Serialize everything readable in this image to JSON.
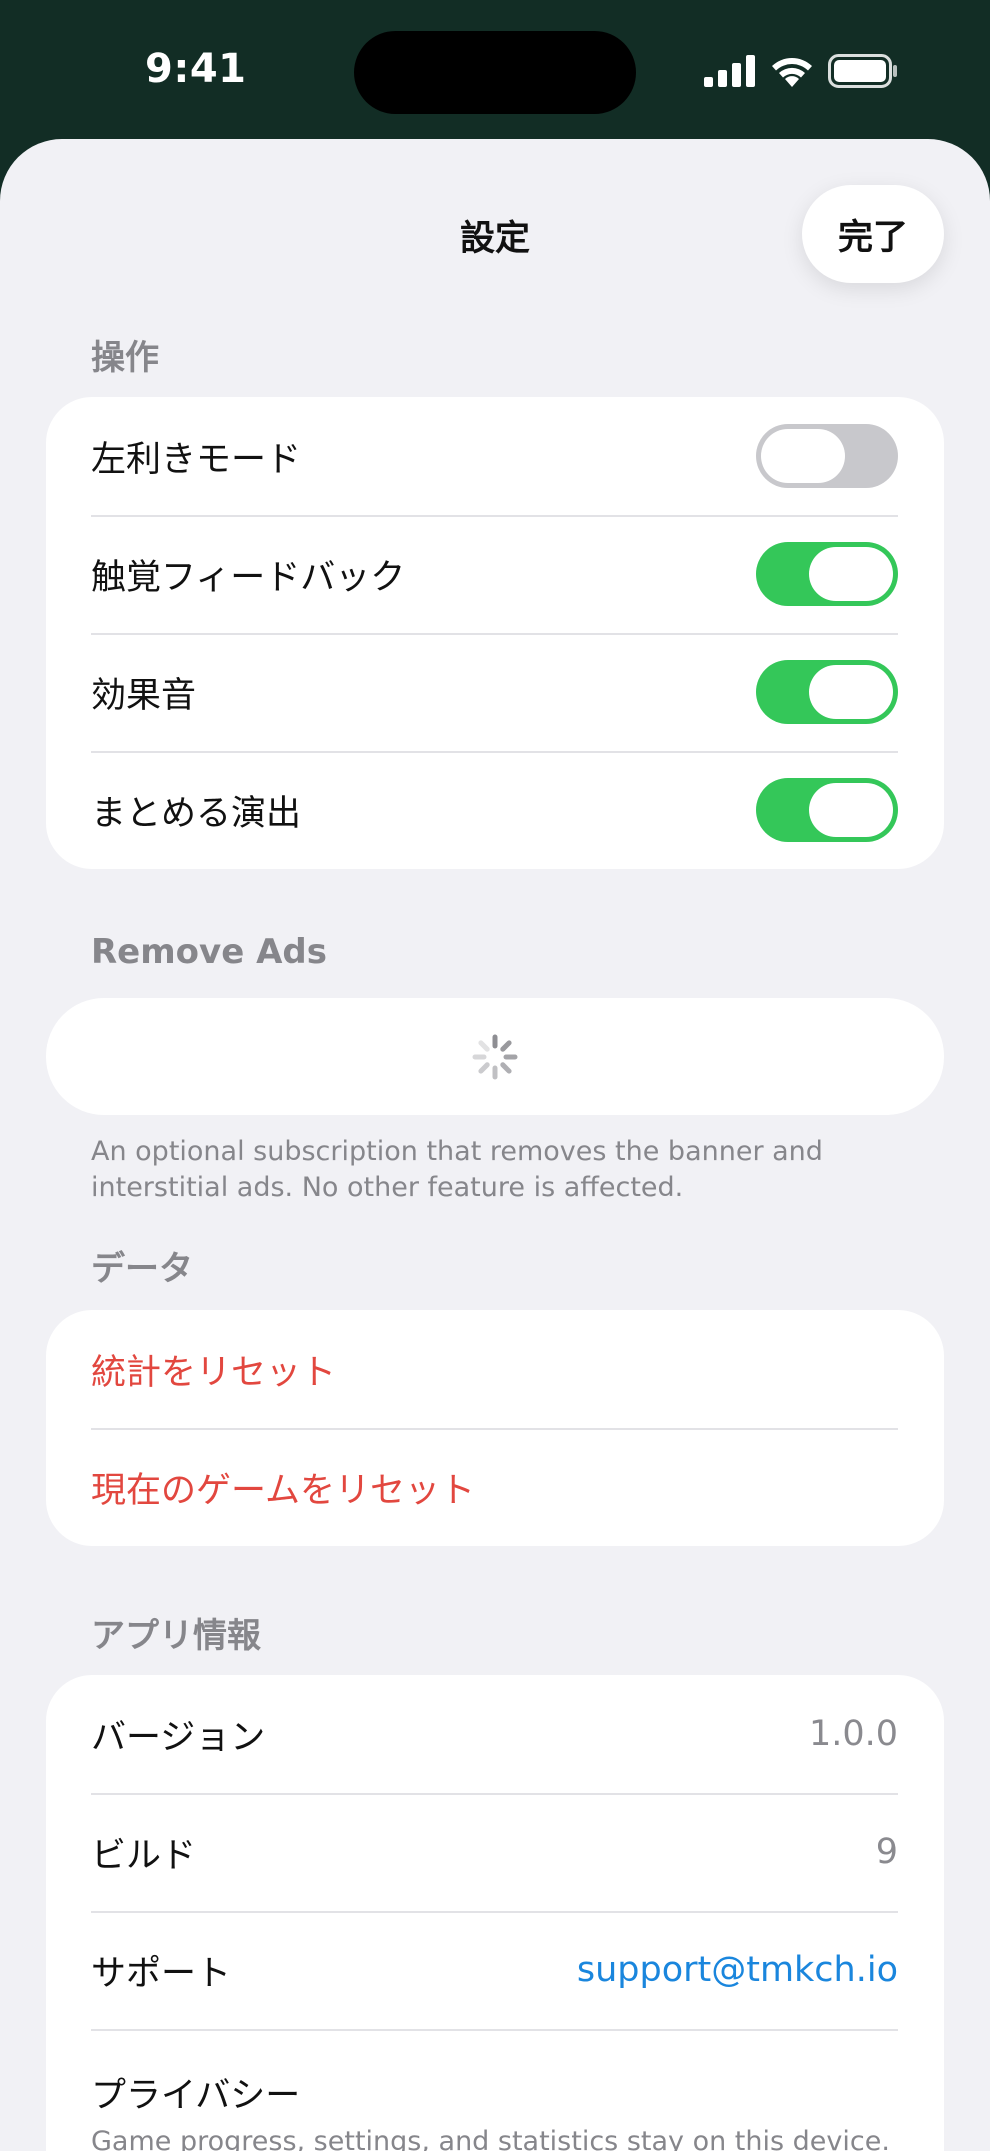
{
  "status_bar": {
    "time": "9:41"
  },
  "header": {
    "title": "設定",
    "done_label": "完了"
  },
  "controls_section": {
    "header": "操作",
    "items": [
      {
        "label": "左利きモード",
        "on": false
      },
      {
        "label": "触覚フィードバック",
        "on": true
      },
      {
        "label": "効果音",
        "on": true
      },
      {
        "label": "まとめる演出",
        "on": true
      }
    ]
  },
  "remove_ads": {
    "header": "Remove Ads",
    "footnote": "An optional subscription that removes the banner and interstitial ads. No other feature is affected."
  },
  "data_section": {
    "header": "データ",
    "items": [
      {
        "label": "統計をリセット"
      },
      {
        "label": "現在のゲームをリセット"
      }
    ]
  },
  "app_info": {
    "header": "アプリ情報",
    "version_label": "バージョン",
    "version_value": "1.0.0",
    "build_label": "ビルド",
    "build_value": "9",
    "support_label": "サポート",
    "support_value": "support@tmkch.io",
    "privacy_label": "プライバシー",
    "privacy_desc": "Game progress, settings, and statistics stay on this device."
  },
  "colors": {
    "toggle_on": "#34c759",
    "destructive": "#e2473f",
    "link": "#1a86dd",
    "status_bar_bg": "#122d25"
  }
}
